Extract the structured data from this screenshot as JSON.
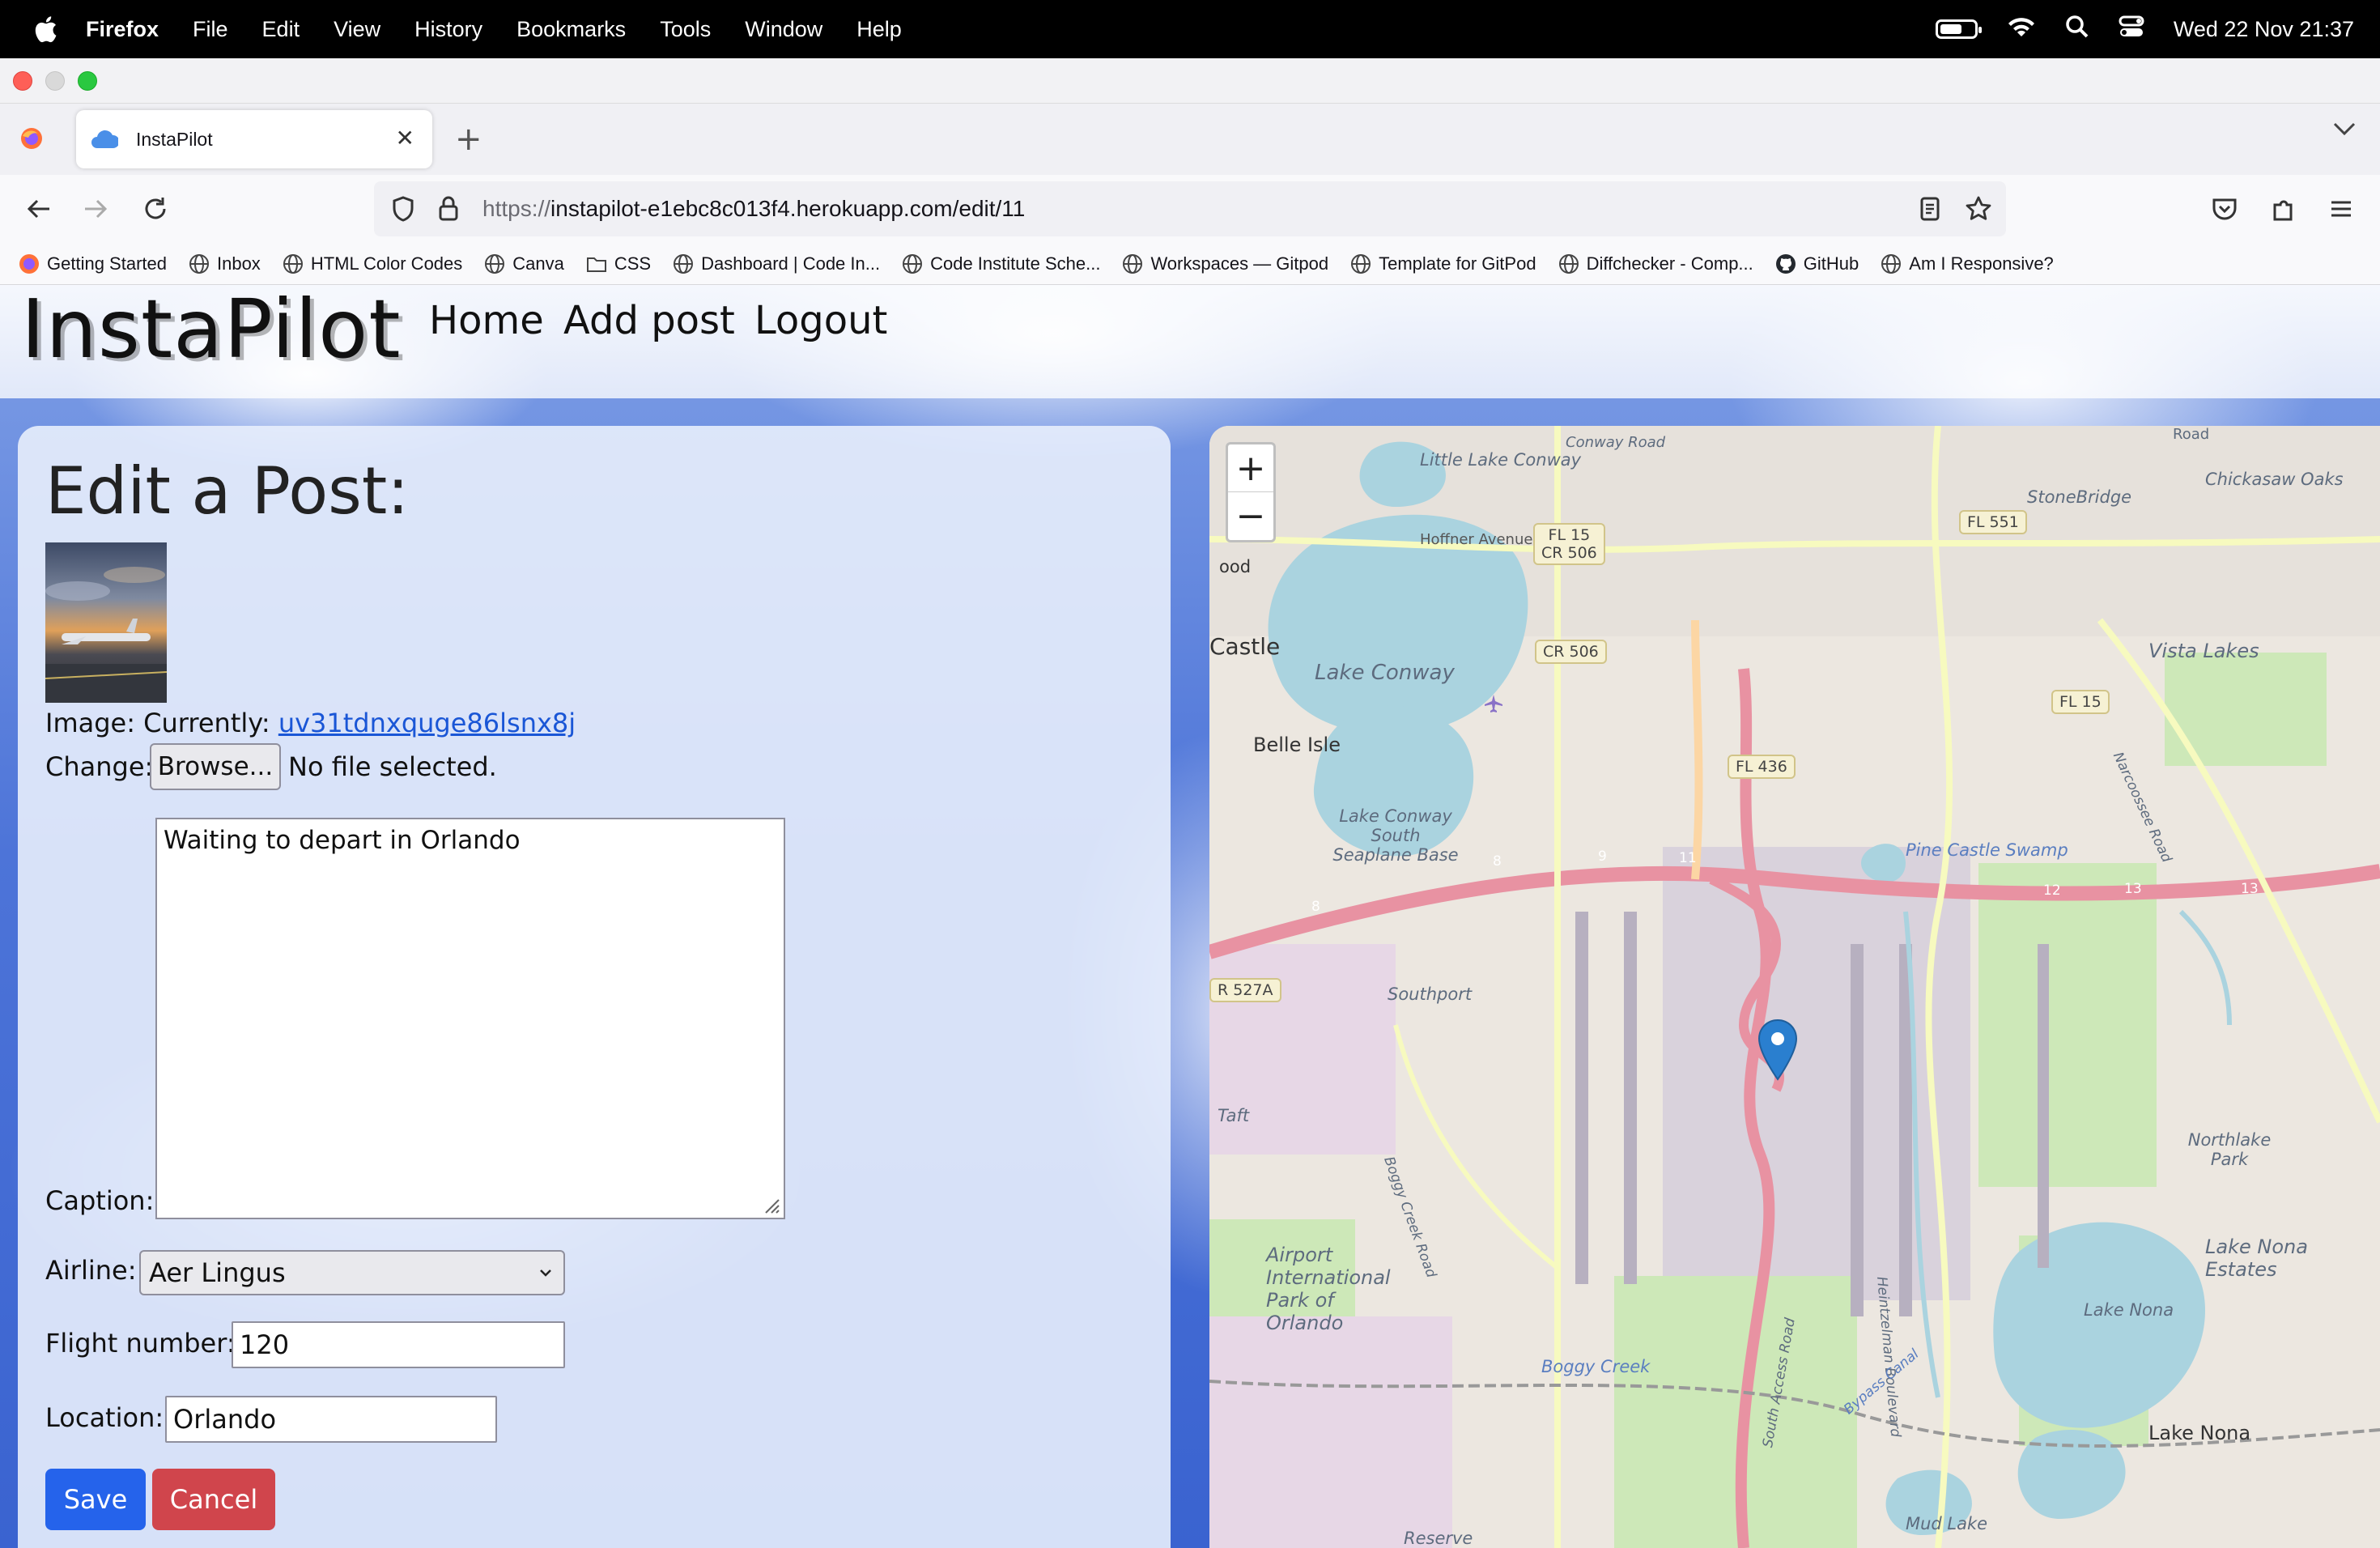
{
  "menubar": {
    "app_name": "Firefox",
    "menus": [
      "File",
      "Edit",
      "View",
      "History",
      "Bookmarks",
      "Tools",
      "Window",
      "Help"
    ],
    "datetime": "Wed 22 Nov  21:37",
    "battery_level": 0.7
  },
  "browser": {
    "tab_title": "InstaPilot",
    "url_protocol": "https://",
    "url_rest": "instapilot-e1ebc8c013f4.herokuapp.com/edit/11",
    "bookmarks": [
      "Getting Started",
      "Inbox",
      "HTML Color Codes",
      "Canva",
      "CSS",
      "Dashboard | Code In...",
      "Code Institute Sche...",
      "Workspaces — Gitpod",
      "Template for GitPod",
      "Diffchecker - Comp...",
      "GitHub",
      "Am I Responsive?"
    ]
  },
  "site": {
    "brand": "InstaPilot",
    "nav": [
      "Home",
      "Add post",
      "Logout"
    ]
  },
  "form": {
    "title": "Edit a Post:",
    "image_label": "Image: Currently:",
    "image_file": "uv31tdnxquge86lsnx8j",
    "change_label": "Change:",
    "browse_label": "Browse...",
    "no_file": "No file selected.",
    "caption_label": "Caption:",
    "caption_value": "Waiting to depart in Orlando",
    "airline_label": "Airline:",
    "airline_value": "Aer Lingus",
    "flight_label": "Flight number:",
    "flight_value": "120",
    "location_label": "Location:",
    "location_value": "Orlando",
    "save_label": "Save",
    "cancel_label": "Cancel"
  },
  "map": {
    "zoom_in": "+",
    "zoom_out": "−",
    "labels": {
      "little_lake_conway": "Little Lake Conway",
      "conway_road": "Conway Road",
      "hoffner": "Hoffner Avenue",
      "stonebridge": "StoneBridge",
      "chickasaw": "Chickasaw Oaks",
      "lake_conway": "Lake Conway",
      "castle": "Castle",
      "belle_isle": "Belle Isle",
      "seaplane": "Lake Conway South Seaplane Base",
      "vista_lakes": "Vista Lakes",
      "pine_castle_swamp": "Pine Castle Swamp",
      "southport": "Southport",
      "taft": "Taft",
      "airport_park": "Airport International Park of Orlando",
      "boggy_creek": "Boggy Creek",
      "boggy_creek_road": "Boggy Creek Road",
      "northlake_park": "Northlake Park",
      "lake_nona_estates": "Lake Nona Estates",
      "lake_nona_lake": "Lake Nona",
      "lake_nona": "Lake Nona",
      "mud_lake": "Mud Lake",
      "reserve": "Reserve",
      "heintzelman": "Heintzelman Boulevard",
      "south_access": "South Access Road",
      "narcoossee": "Narcoossee Road",
      "bypass_canal": "Bypass Canal",
      "ood": "ood",
      "road": "Road"
    },
    "shields": {
      "fl15_cr506": "FL 15\nCR 506",
      "cr506": "CR 506",
      "fl551": "FL 551",
      "fl15": "FL 15",
      "fl436": "FL 436",
      "r527a": "R 527A"
    },
    "exit_numbers": [
      "8",
      "9",
      "11",
      "12",
      "13",
      "13",
      "8"
    ]
  },
  "colors": {
    "primary_button": "#2563eb",
    "danger_button": "#d0454c",
    "link": "#1a56d6"
  }
}
